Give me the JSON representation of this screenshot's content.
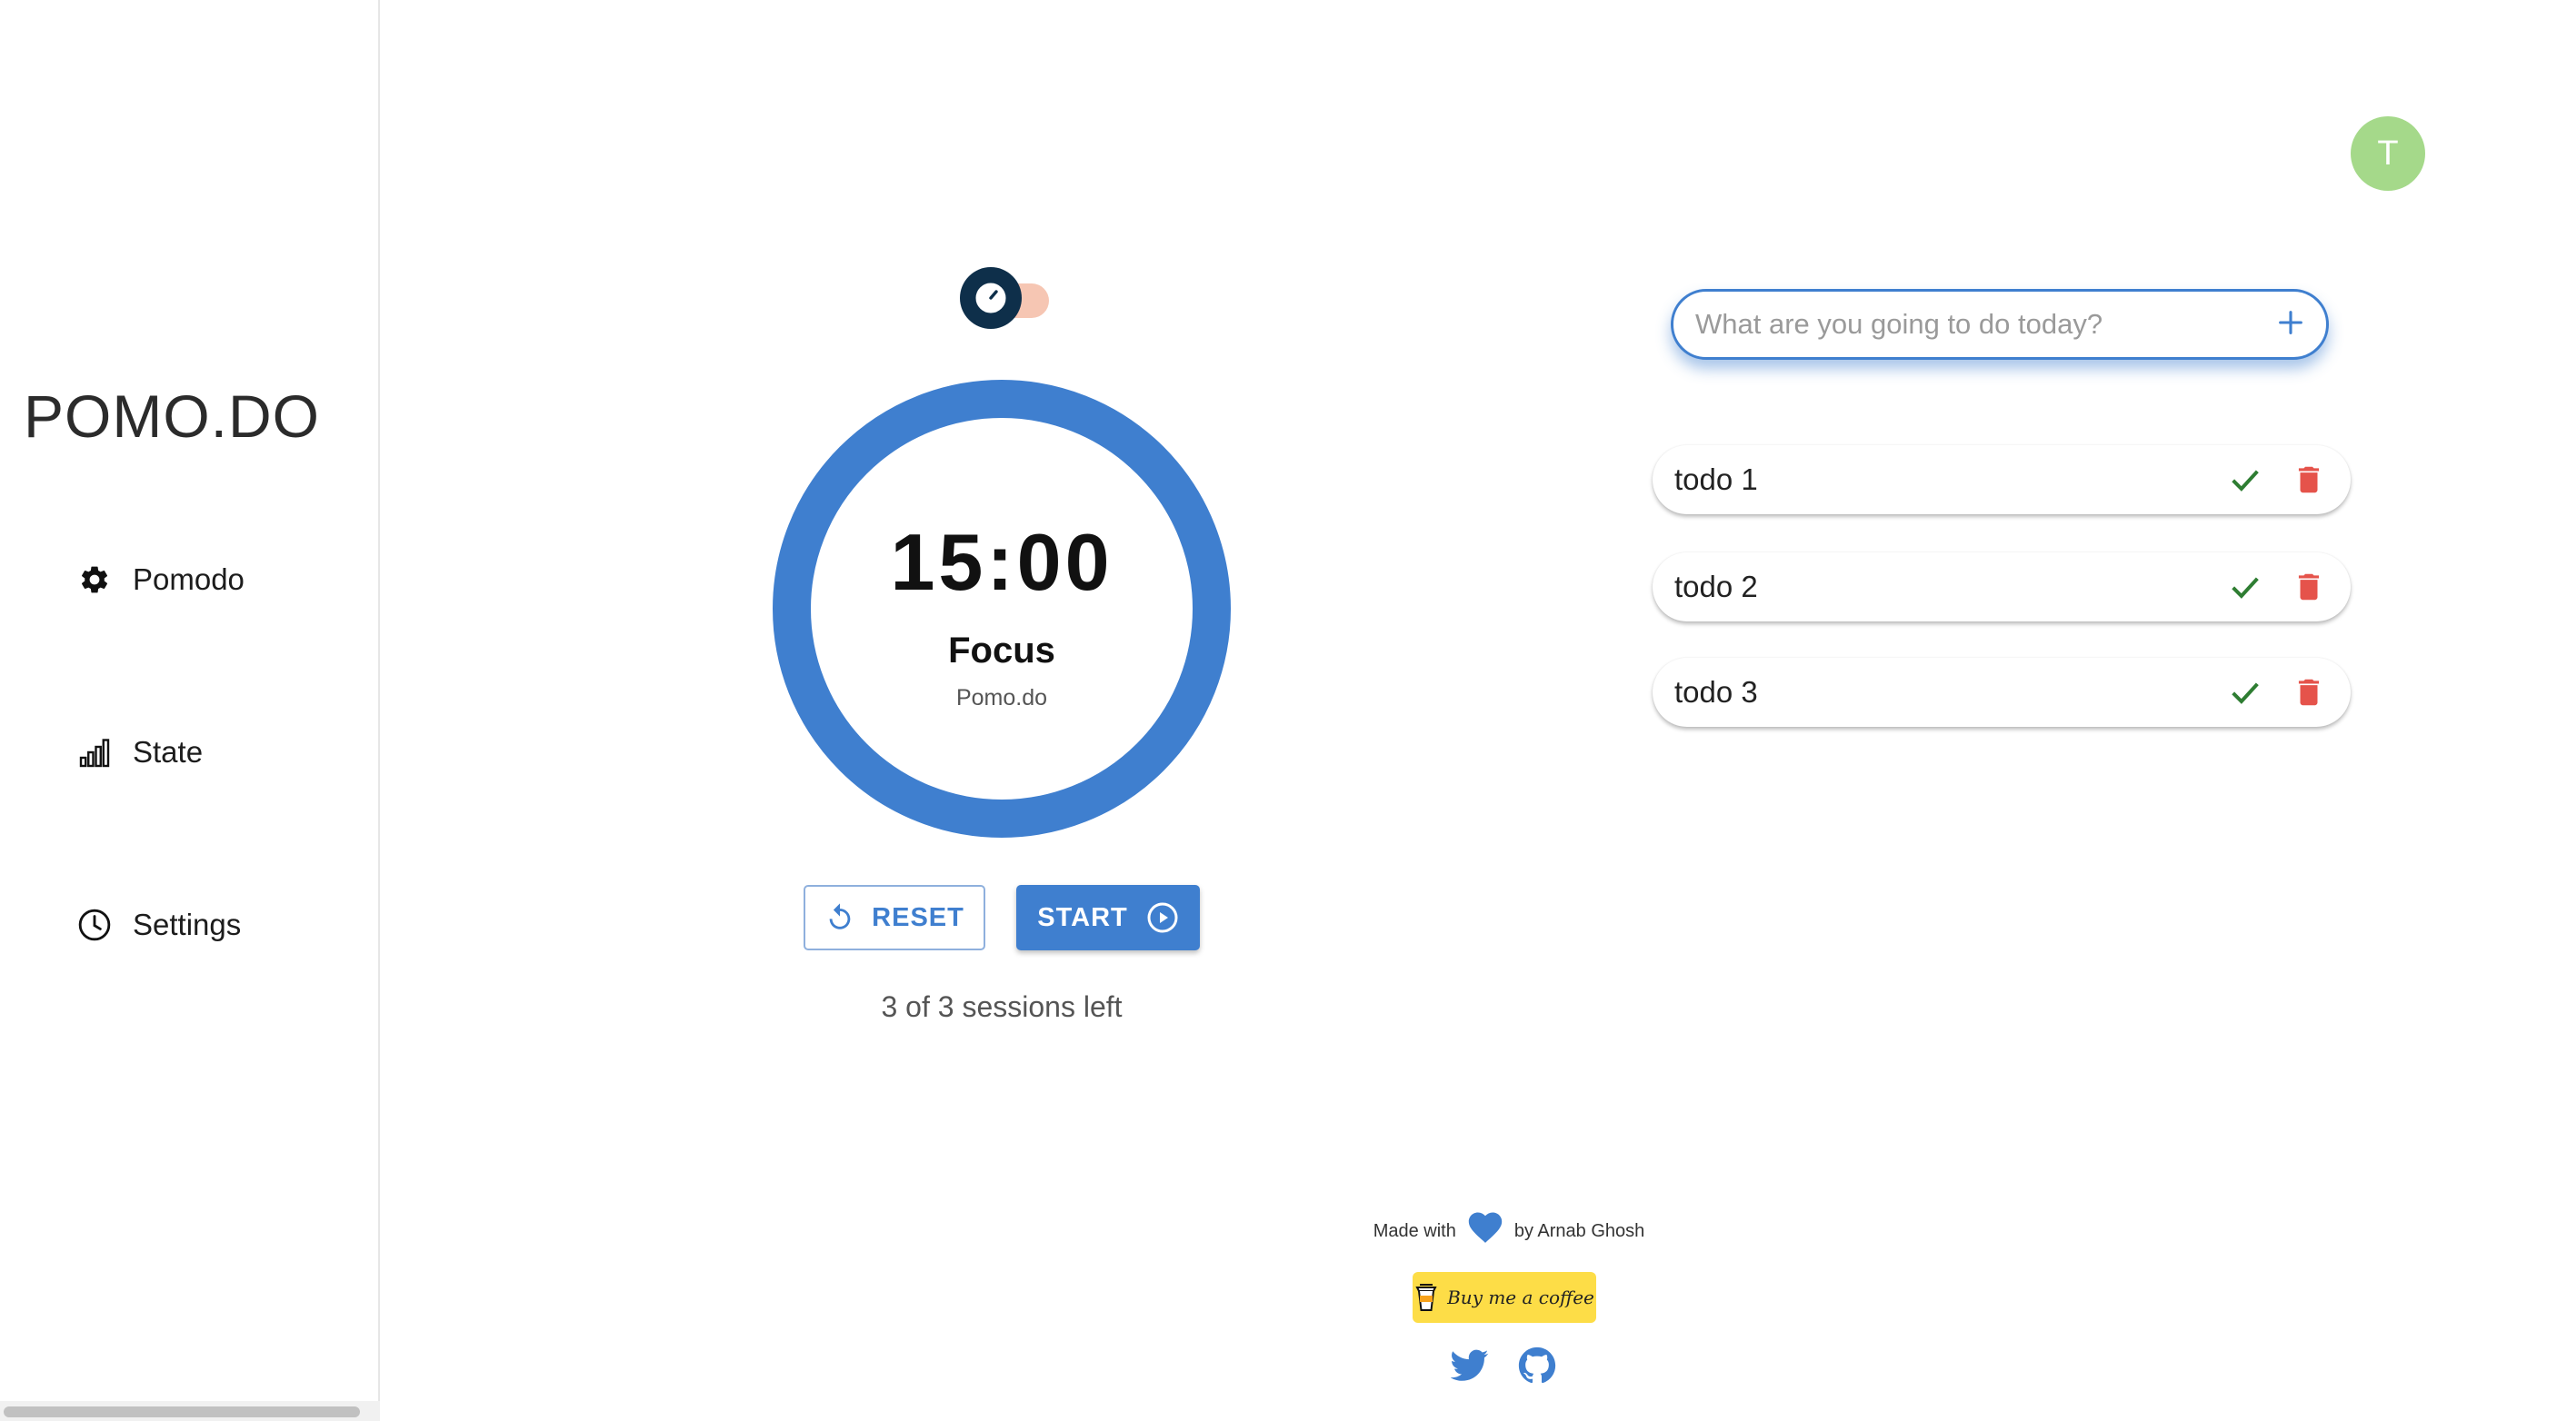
{
  "sidebar": {
    "brand": "POMO.DO",
    "items": [
      {
        "label": "Pomodo",
        "icon": "gear-icon"
      },
      {
        "label": "State",
        "icon": "bar-chart-icon"
      },
      {
        "label": "Settings",
        "icon": "clock-icon"
      }
    ]
  },
  "avatar": {
    "initial": "T",
    "color": "#a5d98a"
  },
  "timer": {
    "time": "15:00",
    "mode": "Focus",
    "subtitle": "Pomo.do",
    "ring_color": "#3f7fcf"
  },
  "controls": {
    "reset_label": "RESET",
    "start_label": "START",
    "sessions_text": "3 of 3 sessions left"
  },
  "todo": {
    "placeholder": "What are you going to do today?",
    "value": "",
    "items": [
      {
        "text": "todo 1"
      },
      {
        "text": "todo 2"
      },
      {
        "text": "todo 3"
      }
    ]
  },
  "footer": {
    "made_with_prefix": "Made with",
    "made_with_suffix": "by Arnab Ghosh",
    "coffee_label": "Buy me a coffee",
    "coffee_color": "#fddd47"
  },
  "colors": {
    "accent": "#3f7fcf",
    "check": "#2e7d32",
    "delete": "#e5534b"
  }
}
